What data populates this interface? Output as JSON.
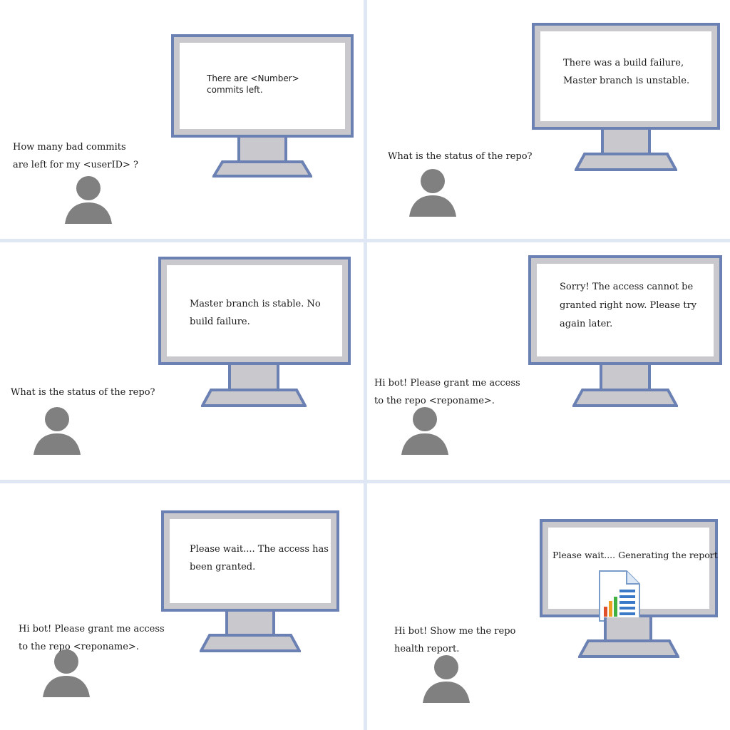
{
  "panels": [
    {
      "question": "How many bad commits\nare left for my <userID> ?",
      "reply": "There  are <Number>\ncommits left."
    },
    {
      "question": "What is the status of the repo?",
      "reply": "There was a build failure,\nMaster branch is unstable."
    },
    {
      "question": "What is the status of the repo?",
      "reply": "Master branch is stable. No\nbuild failure."
    },
    {
      "question": "Hi bot! Please grant me access\nto the repo <reponame>.",
      "reply": "Sorry! The access cannot be\ngranted right now. Please try\nagain later."
    },
    {
      "question": "Hi bot! Please grant me access\nto the repo <reponame>.",
      "reply": "Please wait.... The access has\nbeen granted."
    },
    {
      "question": "Hi bot! Show me the repo\nhealth report.",
      "reply": "Please wait.... Generating the report",
      "reply_icon": "report-chart-icon"
    }
  ],
  "colors": {
    "monitor_frame": "#6b80b3",
    "monitor_bezel": "#c9c9cd",
    "user_avatar": "#808080",
    "panel_gap": "#dfe7f5"
  },
  "icons": {
    "user": "user-avatar-icon",
    "monitor": "desktop-monitor-icon"
  }
}
